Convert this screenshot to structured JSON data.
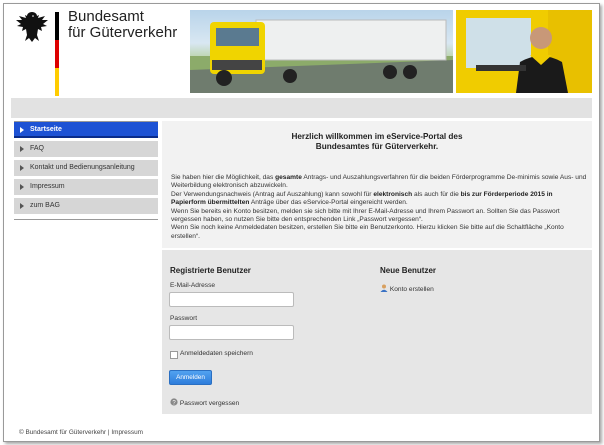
{
  "header": {
    "agency_line1": "Bundesamt",
    "agency_line2": "für Güterverkehr",
    "flag_colors": [
      "#000000",
      "#dd0000",
      "#ffcc00"
    ]
  },
  "sidebar": {
    "items": [
      {
        "label": "Startseite",
        "active": true
      },
      {
        "label": "FAQ",
        "active": false
      },
      {
        "label": "Kontakt und Bedienungsanleitung",
        "active": false
      },
      {
        "label": "Impressum",
        "active": false
      },
      {
        "label": "zum BAG",
        "active": false
      }
    ],
    "active_color": "#1d52d4"
  },
  "main": {
    "title_line1": "Herzlich willkommen im eService-Portal des",
    "title_line2": "Bundesamtes für Güterverkehr.",
    "p1_a": "Sie haben hier die Möglichkeit, das ",
    "p1_b": "gesamte",
    "p1_c": " Antrags- und Auszahlungsverfahren für die beiden Förderprogramme De-minimis sowie Aus- und Weiterbildung elektronisch abzuwickeln.",
    "p2_a": "Der Verwendungsnachweis (Antrag auf Auszahlung) kann sowohl für ",
    "p2_b": "elektronisch",
    "p2_c": " als auch für die ",
    "p2_d": "bis zur Förderperiode 2015 in Papierform übermittelten",
    "p2_e": " Anträge  über das eService-Portal eingereicht werden.",
    "p3": "Wenn Sie bereits ein Konto besitzen, melden sie sich bitte mit Ihrer E-Mail-Adresse und Ihrem Passwort an. Sollten Sie das Passwort vergessen haben, so nutzen Sie bitte den entsprechenden Link „Passwort vergessen“.",
    "p4": "Wenn Sie noch keine Anmeldedaten besitzen, erstellen Sie bitte ein Benutzerkonto. Hierzu klicken Sie bitte auf die Schaltfläche „Konto erstellen“."
  },
  "login": {
    "registered_title": "Registrierte Benutzer",
    "email_label": "E-Mail-Adresse",
    "email_value": "",
    "password_label": "Passwort",
    "password_value": "",
    "remember_label": "Anmeldedaten speichern",
    "submit_label": "Anmelden",
    "forgot_label": "Passwort vergessen",
    "new_title": "Neue Benutzer",
    "create_label": "Konto erstellen",
    "button_color": "#2e7ddb"
  },
  "footer": {
    "copyright": "© Bundesamt für Güterverkehr",
    "separator": " | ",
    "impressum": "Impressum"
  }
}
